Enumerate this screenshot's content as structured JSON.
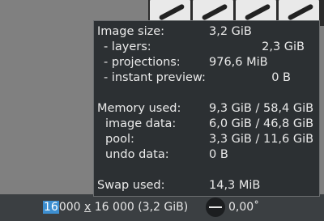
{
  "tooltip": {
    "image_size": {
      "label": "Image size:",
      "value": "3,2 GiB"
    },
    "layers": {
      "label": "- layers:",
      "value": "2,3 GiB"
    },
    "projections": {
      "label": "- projections:",
      "value": "976,6 MiB"
    },
    "instant_preview": {
      "label": "- instant preview:",
      "value": "0 B"
    },
    "memory_used": {
      "label": "Memory used:",
      "value": "9,3 GiB / 58,4 GiB"
    },
    "image_data": {
      "label": "image data:",
      "value": "6,0 GiB / 46,8 GiB"
    },
    "pool": {
      "label": "pool:",
      "value": "3,3 GiB / 11,6 GiB"
    },
    "undo_data": {
      "label": "undo data:",
      "value": "0 B"
    },
    "swap_used": {
      "label": "Swap used:",
      "value": "14,3 MiB"
    }
  },
  "statusbar": {
    "width_selected": "16",
    "width_rest": "000",
    "times": "x",
    "height_and_size": "16 000 (3,2 GiB)",
    "rotation": "0,00˚"
  }
}
